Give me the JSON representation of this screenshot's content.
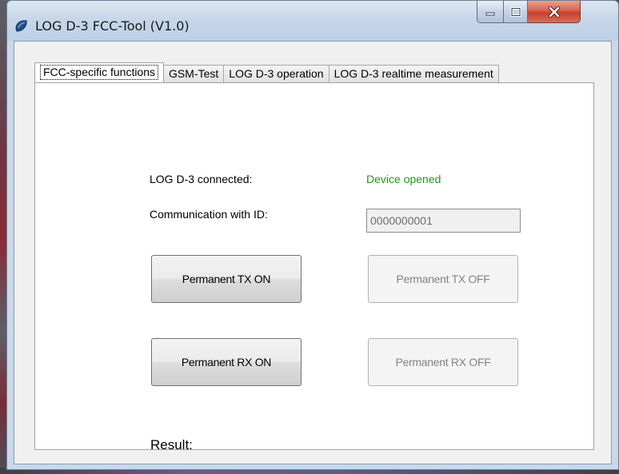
{
  "window": {
    "title": "LOG D-3 FCC-Tool (V1.0)",
    "icon": "app-icon"
  },
  "tabs": [
    {
      "label": "FCC-specific functions",
      "active": true
    },
    {
      "label": "GSM-Test",
      "active": false
    },
    {
      "label": "LOG D-3 operation",
      "active": false
    },
    {
      "label": "LOG D-3 realtime measurement",
      "active": false
    }
  ],
  "panel": {
    "connected_label": "LOG D-3 connected:",
    "connected_status": "Device opened",
    "comm_label": "Communication with ID:",
    "comm_id": "0000000001",
    "buttons": {
      "tx_on": "Permanent TX ON",
      "tx_off": "Permanent TX OFF",
      "rx_on": "Permanent RX ON",
      "rx_off": "Permanent RX OFF"
    },
    "result_label": "Result:"
  },
  "colors": {
    "status_green": "#1c9a1c",
    "close_red": "#c4402a"
  }
}
